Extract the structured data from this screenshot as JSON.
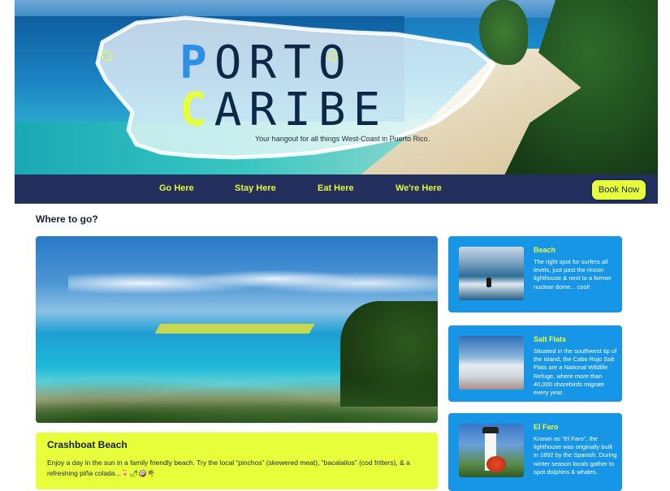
{
  "hero": {
    "title_line1_first": "P",
    "title_line1_rest": "ORTO",
    "title_line2_first": "C",
    "title_line2_rest": "ARIBE",
    "tagline": "Your hangout for all things West-Coast in Puerto Rico."
  },
  "nav": {
    "links": [
      "Go Here",
      "Stay Here",
      "Eat Here",
      "We're Here"
    ],
    "book_label": "Book Now"
  },
  "section": {
    "title": "Where to go?"
  },
  "feature": {
    "title": "Crashboat Beach",
    "description": "Enjoy a day in the sun in a family friendly beach. Try the local “pinchos” (skewered meat), “bacalaitos” (cod fritters), & a refreshing piña colada...🍹🌶🥥🌴"
  },
  "cards": [
    {
      "title": "Beach",
      "description": "The right spot for surfers all levels, just past the rincon lighthouse & next to a former nuclear dome... cool!"
    },
    {
      "title": "Salt Flats",
      "description": "Situated in the southwest tip of the island, the Cabo Rojo Salt Flats are a National Wildlife Refuge, where more than 40,000 shorebirds migrate every year."
    },
    {
      "title": "El Faro",
      "description": "Known as “El Faro”, the lighthouse was originally built in 1892 by the Spanish. During winter season locals gather to spot dolphins & whales."
    }
  ],
  "colors": {
    "nav_bg": "#232f5c",
    "accent_yellow": "#e6ff3a",
    "card_blue": "#1796e8",
    "title_blue": "#2f8fe6"
  }
}
